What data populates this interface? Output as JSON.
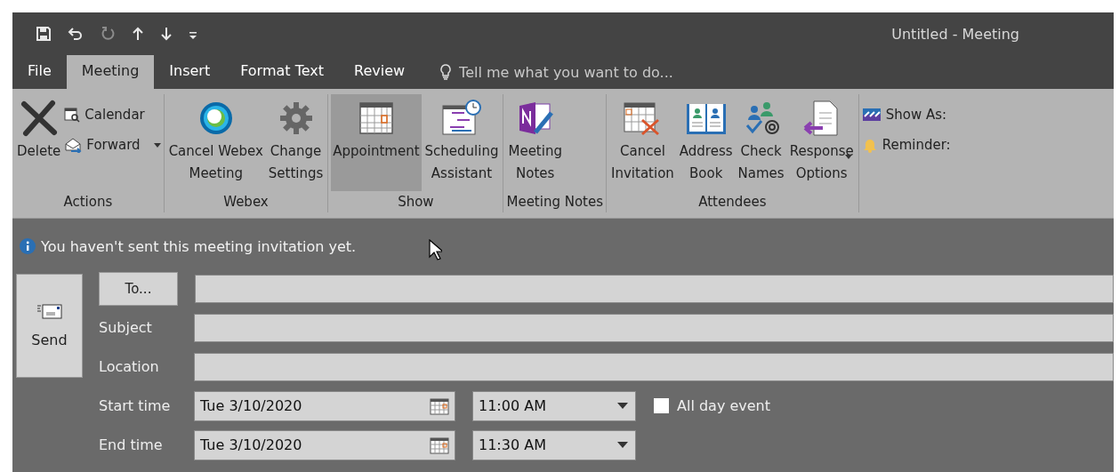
{
  "window": {
    "title": "Untitled - Meeting"
  },
  "quick_access": [
    {
      "kind": "save",
      "disabled": false
    },
    {
      "kind": "undo",
      "disabled": false
    },
    {
      "kind": "redo",
      "disabled": true
    },
    {
      "kind": "up",
      "disabled": false
    },
    {
      "kind": "down",
      "disabled": false
    },
    {
      "kind": "customize",
      "disabled": false
    }
  ],
  "tabs": [
    {
      "label": "File",
      "selected": false
    },
    {
      "label": "Meeting",
      "selected": true
    },
    {
      "label": "Insert",
      "selected": false
    },
    {
      "label": "Format Text",
      "selected": false
    },
    {
      "label": "Review",
      "selected": false
    }
  ],
  "tell_me": {
    "placeholder": "Tell me what you want to do..."
  },
  "ribbon_groups": [
    {
      "label": "Actions",
      "items": [
        {
          "kind": "large",
          "label": "Delete",
          "selected": false
        },
        {
          "kind": "stack",
          "items": [
            {
              "label": "Calendar",
              "dropdown": false
            },
            {
              "label": "Forward",
              "dropdown": true
            }
          ]
        }
      ]
    },
    {
      "label": "Webex",
      "items": [
        {
          "kind": "large",
          "label": "Cancel Webex\nMeeting",
          "selected": false
        },
        {
          "kind": "large",
          "label": "Change\nSettings",
          "selected": false
        }
      ]
    },
    {
      "label": "Show",
      "items": [
        {
          "kind": "large",
          "label": "Appointment",
          "selected": true
        },
        {
          "kind": "large",
          "label": "Scheduling\nAssistant",
          "selected": false
        }
      ]
    },
    {
      "label": "Meeting Notes",
      "items": [
        {
          "kind": "large",
          "label": "Meeting\nNotes",
          "selected": false
        }
      ]
    },
    {
      "label": "Attendees",
      "items": [
        {
          "kind": "large",
          "label": "Cancel\nInvitation",
          "selected": false
        },
        {
          "kind": "large",
          "label": "Address\nBook",
          "selected": false
        },
        {
          "kind": "large",
          "label": "Check\nNames",
          "selected": false
        },
        {
          "kind": "large",
          "label": "Response\nOptions",
          "selected": false,
          "dropdown": true
        }
      ]
    },
    {
      "items": [
        {
          "kind": "stack",
          "items": [
            {
              "label": "Show As:",
              "dropdown": false
            },
            {
              "label": "Reminder:",
              "dropdown": false
            }
          ]
        }
      ]
    }
  ],
  "info_bar": {
    "message": "You haven't sent this meeting invitation yet."
  },
  "form": {
    "send_button": "Send",
    "to_button": "To...",
    "rows": [
      {
        "kind": "to"
      },
      {
        "kind": "text",
        "label": "Subject"
      },
      {
        "kind": "text",
        "label": "Location"
      },
      {
        "kind": "time",
        "label": "Start time",
        "date": "Tue 3/10/2020",
        "time": "11:00 AM",
        "all_day": {
          "label": "All day event",
          "checked": false
        }
      },
      {
        "kind": "time",
        "label": "End time",
        "date": "Tue 3/10/2020",
        "time": "11:30 AM"
      }
    ]
  }
}
